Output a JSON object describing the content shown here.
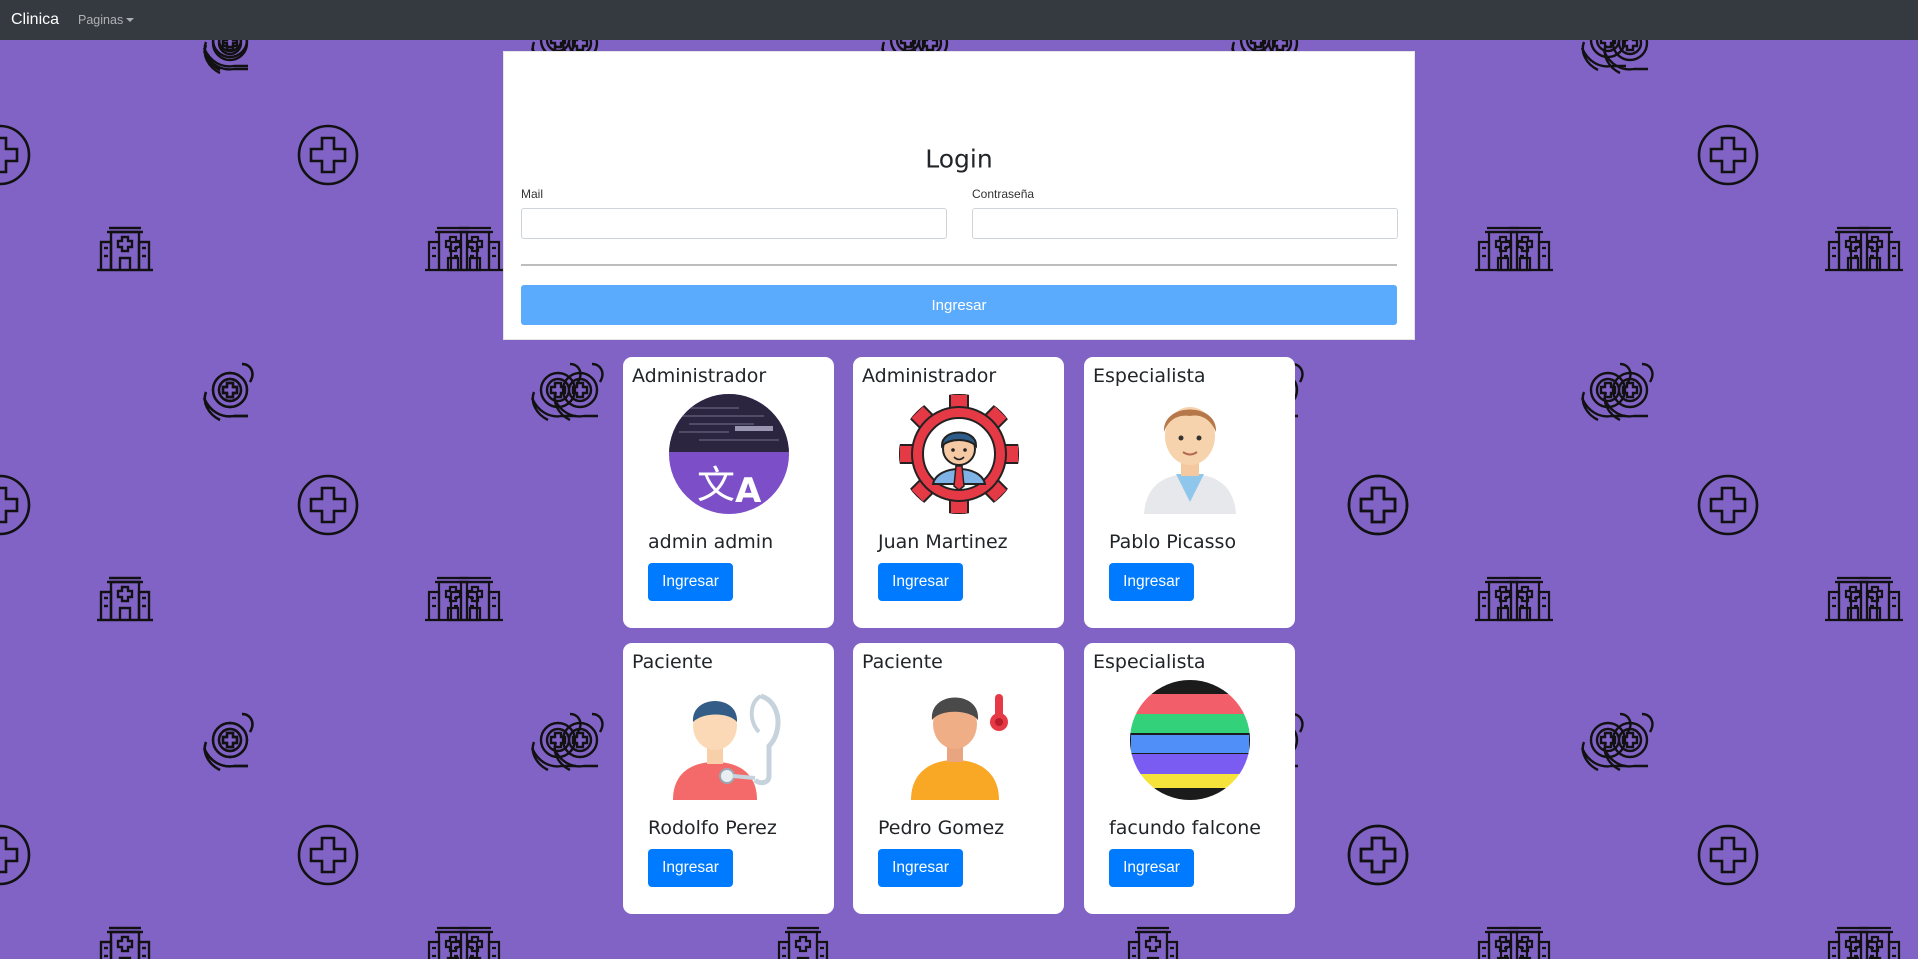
{
  "navbar": {
    "brand": "Clinica",
    "menu_label": "Paginas"
  },
  "login": {
    "title": "Login",
    "mail_label": "Mail",
    "mail_value": "",
    "password_label": "Contraseña",
    "password_value": "",
    "submit_label": "Ingresar"
  },
  "users": [
    {
      "role": "Administrador",
      "name": "admin admin",
      "button": "Ingresar",
      "avatar_icon": "translate-app-avatar"
    },
    {
      "role": "Administrador",
      "name": "Juan Martinez",
      "button": "Ingresar",
      "avatar_icon": "gear-person-avatar"
    },
    {
      "role": "Especialista",
      "name": "Pablo Picasso",
      "button": "Ingresar",
      "avatar_icon": "doctor-avatar"
    },
    {
      "role": "Paciente",
      "name": "Rodolfo Perez",
      "button": "Ingresar",
      "avatar_icon": "stethoscope-patient-avatar"
    },
    {
      "role": "Paciente",
      "name": "Pedro Gomez",
      "button": "Ingresar",
      "avatar_icon": "thermometer-patient-avatar"
    },
    {
      "role": "Especialista",
      "name": "facundo falcone",
      "button": "Ingresar",
      "avatar_icon": "rainbow-stripes-avatar"
    }
  ],
  "colors": {
    "background": "#8163c6",
    "navbar": "#343a40",
    "primary_button": "#007bff",
    "login_button": "#5aabfe"
  }
}
